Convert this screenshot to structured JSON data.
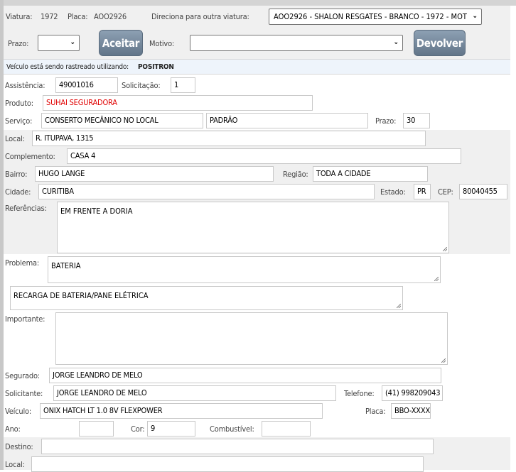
{
  "header": {
    "viatura_label": "Viatura:",
    "viatura": "1972",
    "placa_label": "Placa:",
    "placa": "AOO2926",
    "direciona_label": "Direciona para outra viatura:",
    "direciona_value": "AOO2926 - SHALON RESGATES - BRANCO - 1972 - MOT",
    "prazo_label": "Prazo:",
    "prazo_value": "",
    "aceitar": "Aceitar",
    "motivo_label": "Motivo:",
    "motivo_value": "",
    "devolver": "Devolver"
  },
  "tracking": {
    "text": "Veículo está sendo rastreado utilizando:",
    "provider": "POSITRON"
  },
  "form": {
    "assistencia_label": "Assistência:",
    "assistencia": "49001016",
    "solicitacao_label": "Solicitação:",
    "solicitacao": "1",
    "produto_label": "Produto:",
    "produto": "SUHAI SEGURADORA",
    "servico_label": "Serviço:",
    "servico": "CONSERTO MECÂNICO NO LOCAL",
    "servico_tipo": "PADRÃO",
    "prazo_label": "Prazo:",
    "prazo": "30",
    "local_label": "Local:",
    "local": "R. ITUPAVA, 1315",
    "complemento_label": "Complemento:",
    "complemento": "CASA 4",
    "bairro_label": "Bairro:",
    "bairro": "HUGO LANGE",
    "regiao_label": "Região:",
    "regiao": "TODA A CIDADE",
    "cidade_label": "Cidade:",
    "cidade": "CURITIBA",
    "estado_label": "Estado:",
    "estado": "PR",
    "cep_label": "CEP:",
    "cep": "80040455",
    "referencias_label": "Referências:",
    "referencias": "EM FRENTE A DORIA",
    "problema_label": "Problema:",
    "problema": "BATERIA",
    "problema_detalhe": "RECARGA DE BATERIA/PANE ELÉTRICA",
    "importante_label": "Importante:",
    "importante": "",
    "segurado_label": "Segurado:",
    "segurado": "JORGE LEANDRO DE MELO",
    "solicitante_label": "Solicitante:",
    "solicitante": "JORGE LEANDRO DE MELO",
    "telefone_label": "Telefone:",
    "telefone": "(41) 998209043",
    "veiculo_label": "Veículo:",
    "veiculo": "ONIX HATCH LT 1.0 8V FLEXPOWER",
    "placa_label": "Placa:",
    "placa": "BBO-XXXX",
    "ano_label": "Ano:",
    "ano": "",
    "cor_label": "Cor:",
    "cor": "9",
    "combustivel_label": "Combustível:",
    "combustivel": "",
    "destino_label": "Destino:",
    "destino": "",
    "destino_local_label": "Local:",
    "destino_local": ""
  },
  "colors": {
    "produto": "#e00000",
    "button": "#6f8296",
    "tracking_bg": "#eef4fb"
  }
}
